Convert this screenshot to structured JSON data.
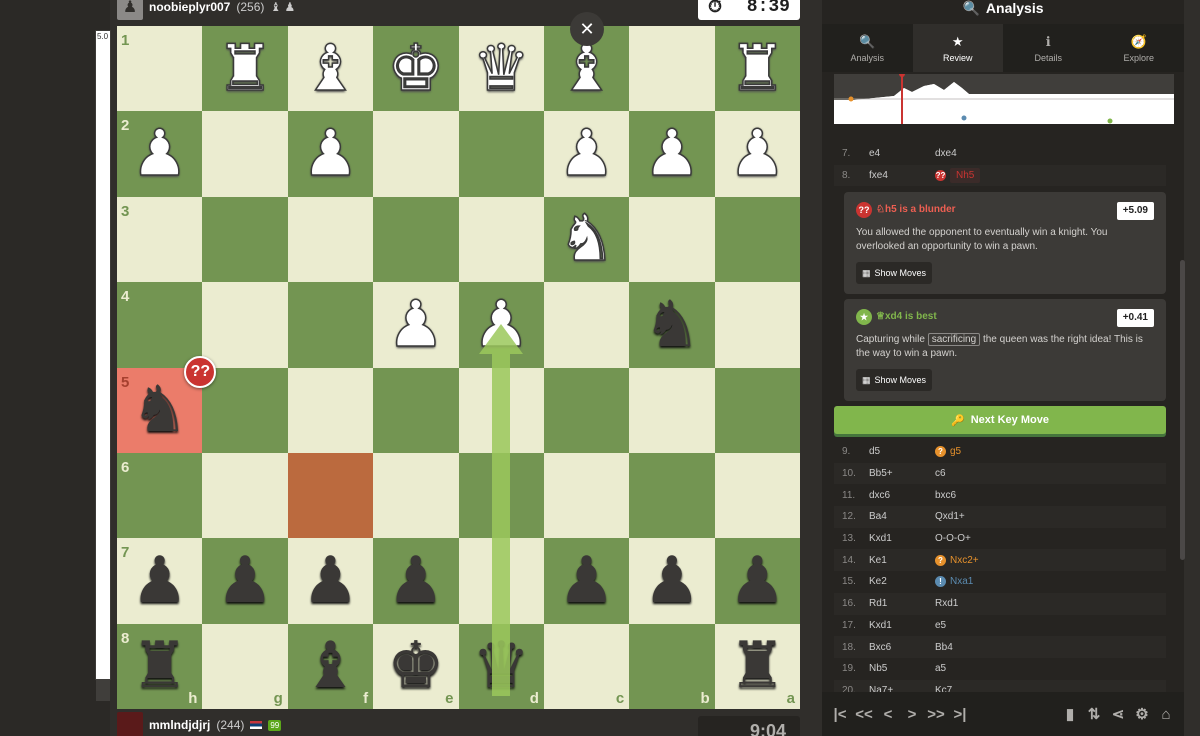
{
  "players": {
    "top": {
      "name": "noobieplyr007",
      "rating": "(256)",
      "captured": "♝ ♟"
    },
    "bottom": {
      "name": "mmlndjdjrj",
      "rating": "(244)",
      "badge": "99"
    }
  },
  "clocks": {
    "top": "8:39",
    "bottom": "9:04"
  },
  "eval_bar": {
    "label": "5.0"
  },
  "board": {
    "ranks": [
      "1",
      "2",
      "3",
      "4",
      "5",
      "6",
      "7",
      "8"
    ],
    "files": [
      "h",
      "g",
      "f",
      "e",
      "d",
      "c",
      "b",
      "a"
    ],
    "rows": [
      [
        "",
        "wR",
        "wB",
        "wK",
        "wQ",
        "wB",
        "",
        "wR"
      ],
      [
        "wP",
        "",
        "wP",
        "",
        "",
        "wP",
        "wP",
        "wP"
      ],
      [
        "",
        "",
        "",
        "",
        "",
        "wN",
        "",
        ""
      ],
      [
        "",
        "",
        "",
        "wP",
        "wP",
        "",
        "bN",
        ""
      ],
      [
        "bN",
        "",
        "",
        "",
        "",
        "",
        "",
        ""
      ],
      [
        "",
        "",
        "",
        "",
        "",
        "",
        "",
        ""
      ],
      [
        "bP",
        "bP",
        "bP",
        "bP",
        "",
        "bP",
        "bP",
        "bP"
      ],
      [
        "bR",
        "",
        "bB",
        "bK",
        "bQ",
        "",
        "",
        "bR"
      ]
    ],
    "blunder_mark": "??",
    "close": "✕"
  },
  "panel": {
    "title": "Analysis",
    "tabs": [
      {
        "label": "Analysis",
        "icon": "🔍"
      },
      {
        "label": "Review",
        "icon": "★"
      },
      {
        "label": "Details",
        "icon": "ℹ"
      },
      {
        "label": "Explore",
        "icon": "🧭"
      }
    ],
    "moves_top": [
      {
        "num": "7.",
        "white": "e4",
        "black": "dxe4"
      },
      {
        "num": "8.",
        "white": "fxe4",
        "black": "Nh5",
        "mark": "??"
      }
    ],
    "card1": {
      "title": "♘h5  is a blunder",
      "eval": "+5.09",
      "text": "You allowed the opponent to eventually win a knight. You overlooked an opportunity to win a pawn.",
      "button": "Show Moves"
    },
    "card2": {
      "title": "♕xd4  is best",
      "eval": "+0.41",
      "text_a": "Capturing while",
      "text_word": "sacrificing",
      "text_b": "the queen was the right idea! This is the way to win a pawn.",
      "button": "Show Moves"
    },
    "next_button": "Next Key Move",
    "moves": [
      {
        "num": "9.",
        "white": "d5",
        "black": "g5",
        "mark": "?"
      },
      {
        "num": "10.",
        "white": "Bb5+",
        "black": "c6"
      },
      {
        "num": "11.",
        "white": "dxc6",
        "black": "bxc6"
      },
      {
        "num": "12.",
        "white": "Ba4",
        "black": "Qxd1+"
      },
      {
        "num": "13.",
        "white": "Kxd1",
        "black": "O-O-O+"
      },
      {
        "num": "14.",
        "white": "Ke1",
        "black": "Nxc2+",
        "mark": "?"
      },
      {
        "num": "15.",
        "white": "Ke2",
        "black": "Nxa1",
        "mark": "!"
      },
      {
        "num": "16.",
        "white": "Rd1",
        "black": "Rxd1"
      },
      {
        "num": "17.",
        "white": "Kxd1",
        "black": "e5"
      },
      {
        "num": "18.",
        "white": "Bxc6",
        "black": "Bb4"
      },
      {
        "num": "19.",
        "white": "Nb5",
        "black": "a5"
      },
      {
        "num": "20.",
        "white": "Na7+",
        "black": "Kc7"
      }
    ]
  }
}
